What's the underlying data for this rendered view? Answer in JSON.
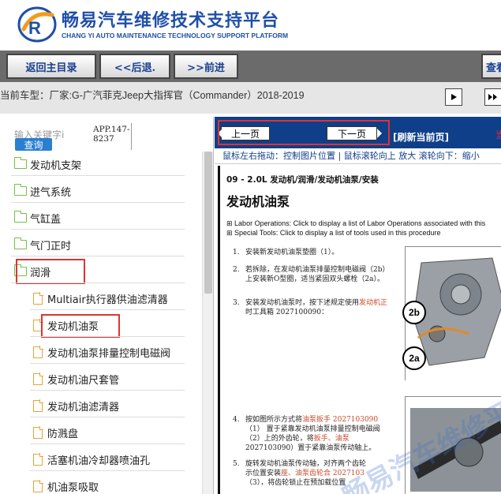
{
  "brand": {
    "title": "畅易汽车维修技术支持平台",
    "subtitle": "CHANG YI AUTO MAINTENANCE TECHNOLOGY SUPPORT PLATFORM"
  },
  "nav": {
    "home_label": "返回主目录",
    "back_label": "<<后退.",
    "forward_label": ">>前进",
    "search_label": "查看"
  },
  "vehicle": {
    "label": "当前车型：",
    "value": "厂家:G-广汽菲克Jeep大指挥官（Commander）2018-2019"
  },
  "search": {
    "placeholder": "输入关键字i",
    "app_code": "APP.147-8237",
    "query_label": "查询"
  },
  "tree": {
    "items": [
      {
        "label": "发动机支架",
        "icon": "folder-icon"
      },
      {
        "label": "进气系统",
        "icon": "folder-icon"
      },
      {
        "label": "气缸盖",
        "icon": "folder-icon"
      },
      {
        "label": "气门正时",
        "icon": "folder-icon"
      },
      {
        "label": "润滑",
        "icon": "folder-icon"
      },
      {
        "label": "Multiair执行器供油滤清器",
        "icon": "doc-icon"
      },
      {
        "label": "发动机油泵",
        "icon": "doc-icon"
      },
      {
        "label": "发动机油泵排量控制电磁阀",
        "icon": "doc-icon"
      },
      {
        "label": "发动机油尺套管",
        "icon": "doc-icon"
      },
      {
        "label": "发动机油滤清器",
        "icon": "doc-icon"
      },
      {
        "label": "防溅盘",
        "icon": "doc-icon"
      },
      {
        "label": "活塞机油冷却器喷油孔",
        "icon": "doc-icon"
      },
      {
        "label": "机油泵吸取",
        "icon": "doc-icon"
      }
    ]
  },
  "pager": {
    "prev_label": "上一页",
    "next_label": "下一页",
    "refresh_label": "[刷新当前页]",
    "marker": "当"
  },
  "hint": "鼠标左右拖动：控制图片位置 | 鼠标滚轮向上 放大  滚轮向下：缩小",
  "doc": {
    "path": "09 - 2.0L 发动机/润滑/发动机油泵/安装",
    "title": "发动机油泵",
    "labor_ops": "Labor Operations: Click to display a list of Labor Operations associated with this",
    "special_tools": "Special Tools: Click to display a list of tools used in this procedure",
    "step1": "安装新发动机油泵垫圈（1）。",
    "step2a": "若拆除，在发动机油泵排量控制电磁阀（2b）",
    "step2b": "上安装新O型圈，适当紧固双头螺栓（2a）。",
    "step3a": "安装发动机油泵时，按下述规定使用",
    "step3a_link": "发动机正",
    "step3b": "时工具箱 2027100090：",
    "step4a": "按如图所示方式将",
    "step4a_link": "油泵扳手 2027103090",
    "step4b": "（1）  置于紧靠发动机油泵排量控制电磁阀",
    "step4c": "（2）上的外齿轮，将",
    "step4c_link": "扳手、油泵",
    "step4d": "2027103090）置于紧靠油泵传动轴上。",
    "step5a": "旋转发动机油泵传动轴，对齐两个齿轮",
    "step5b": "示位置安装",
    "step5b_link": "座、油泵齿轮合 2027103",
    "step5c": "（3），将齿轮锁止在预加载位置",
    "num1": "1.",
    "num2": "2.",
    "num3": "3.",
    "num4": "4.",
    "num5": "5.",
    "callout_2b": "2b",
    "callout_2a": "2a",
    "watermark": "畅易汽车维修平台"
  },
  "colors": {
    "brand_blue": "#1f4fa8",
    "toolbar_gray": "#6b6b6b",
    "pager_blue": "#0f3f88",
    "highlight_red": "#d33333",
    "folder_green": "#76c043",
    "doc_orange": "#e9a33a",
    "query_blue": "#2a7fd1"
  }
}
